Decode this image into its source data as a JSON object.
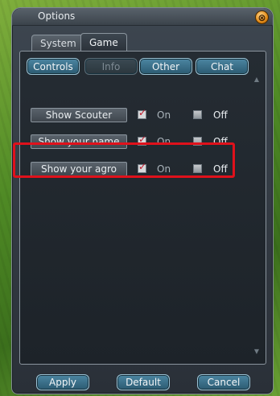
{
  "window": {
    "title": "Options"
  },
  "tabs": [
    {
      "label": "System",
      "active": false
    },
    {
      "label": "Game",
      "active": true
    }
  ],
  "subtabs": [
    {
      "label": "Controls",
      "enabled": true
    },
    {
      "label": "Info",
      "enabled": false
    },
    {
      "label": "Other",
      "enabled": true
    },
    {
      "label": "Chat",
      "enabled": true
    }
  ],
  "options": [
    {
      "label": "Show Scouter",
      "on_label": "On",
      "off_label": "Off",
      "value": "on"
    },
    {
      "label": "Show your name",
      "on_label": "On",
      "off_label": "Off",
      "value": "on"
    },
    {
      "label": "Show your agro",
      "on_label": "On",
      "off_label": "Off",
      "value": "on"
    }
  ],
  "buttons": {
    "apply": "Apply",
    "default": "Default",
    "cancel": "Cancel"
  },
  "colors": {
    "highlight": "#e0111b",
    "accent": "#3a7390"
  },
  "icons": {
    "close": "close-icon",
    "check": "checkmark-icon"
  }
}
